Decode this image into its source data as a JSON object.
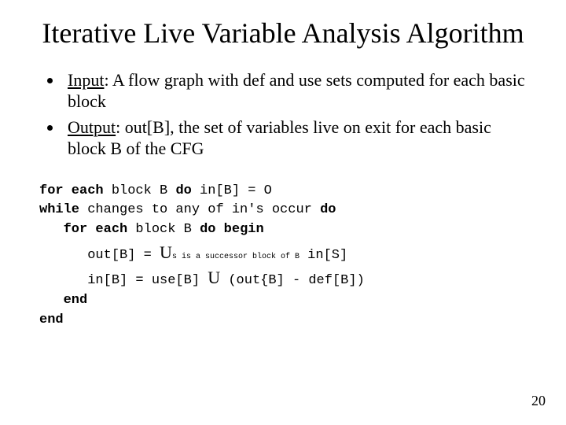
{
  "title": "Iterative Live Variable Analysis Algorithm",
  "bullets": {
    "input_label": "Input",
    "input_text": ": A flow graph with def and use sets computed for each basic block",
    "output_label": "Output",
    "output_text": ": out[B], the set of variables live on exit for each basic block B of the CFG"
  },
  "algo": {
    "kw_for_each_1": "for each",
    "line1_mid": " block B ",
    "kw_do_1": "do",
    "line1_tail": " in[B] = O",
    "kw_while": "while",
    "line2_mid": " changes to any of in's occur ",
    "kw_do_2": "do",
    "indent1": "   ",
    "kw_for_each_2": "for each",
    "line3_mid": " block B ",
    "kw_do_begin": "do begin",
    "indent2": "      ",
    "line4_lhs": "out[B] = ",
    "union_sym_1": "U",
    "line4_sub": "s is a successor block of B",
    "line4_rhs": " in[S]",
    "line5_lhs": "in[B] = use[B] ",
    "union_sym_2": "U",
    "line5_rhs": " (out{B] - def[B])",
    "kw_end_1": "end",
    "kw_end_2": "end"
  },
  "page_number": "20"
}
